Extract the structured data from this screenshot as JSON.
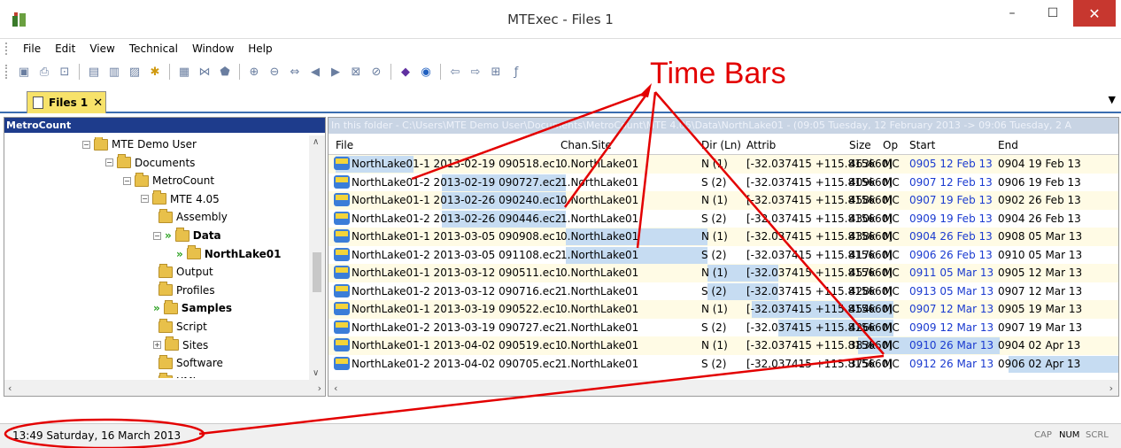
{
  "window": {
    "title": "MTExec - Files 1",
    "minimize": "–",
    "maximize": "☐",
    "close": "✕"
  },
  "menu": {
    "items": [
      "File",
      "Edit",
      "View",
      "Technical",
      "Window",
      "Help"
    ]
  },
  "tab": {
    "label": "Files 1",
    "close": "✕"
  },
  "left_pane": {
    "header": "MetroCount",
    "tree": [
      {
        "label": "MTE Demo User",
        "expander": "-",
        "bold": false,
        "arrows": false
      },
      {
        "label": "Documents",
        "expander": "-",
        "bold": false,
        "arrows": false
      },
      {
        "label": "MetroCount",
        "expander": "-",
        "bold": false,
        "arrows": false
      },
      {
        "label": "MTE 4.05",
        "expander": "-",
        "bold": false,
        "arrows": false
      },
      {
        "label": "Assembly",
        "expander": "",
        "bold": false,
        "arrows": false
      },
      {
        "label": "Data",
        "expander": "-",
        "bold": true,
        "arrows": true
      },
      {
        "label": "NorthLake01",
        "expander": "",
        "bold": true,
        "arrows": true
      },
      {
        "label": "Output",
        "expander": "",
        "bold": false,
        "arrows": false
      },
      {
        "label": "Profiles",
        "expander": "",
        "bold": false,
        "arrows": false
      },
      {
        "label": "Samples",
        "expander": "",
        "bold": true,
        "arrows": true
      },
      {
        "label": "Script",
        "expander": "",
        "bold": false,
        "arrows": false
      },
      {
        "label": "Sites",
        "expander": "+",
        "bold": false,
        "arrows": false
      },
      {
        "label": "Software",
        "expander": "",
        "bold": false,
        "arrows": false
      },
      {
        "label": "XML",
        "expander": "",
        "bold": false,
        "arrows": false
      }
    ]
  },
  "right_pane": {
    "path": "In this folder - C:\\Users\\MTE Demo User\\Documents\\MetroCount\\MTE 4.05\\Data\\NorthLake01 - (09:05 Tuesday, 12 February 2013 -> 09:06 Tuesday, 2 A",
    "columns": [
      "File",
      "Chan.Site",
      "Dir (Ln)",
      "Attrib",
      "Size",
      "Op",
      "Start",
      "End"
    ],
    "rows": [
      {
        "file": "NorthLake01-1 2013-02-19 090518.ec1",
        "chan": "0.NorthLake01",
        "dir": "N (1)",
        "attrib": "[-32.037415 +115.815660]",
        "size": "463k",
        "op": "MC",
        "start": "0905 12 Feb 13",
        "end": "0904 19 Feb 13"
      },
      {
        "file": "NorthLake01-2 2013-02-19 090727.ec2",
        "chan": "1.NorthLake01",
        "dir": "S (2)",
        "attrib": "[-32.037415 +115.815660]",
        "size": "409k",
        "op": "MC",
        "start": "0907 12 Feb 13",
        "end": "0906 19 Feb 13"
      },
      {
        "file": "NorthLake01-1 2013-02-26 090240.ec1",
        "chan": "0.NorthLake01",
        "dir": "N (1)",
        "attrib": "[-32.037415 +115.815660]",
        "size": "458k",
        "op": "MC",
        "start": "0907 19 Feb 13",
        "end": "0902 26 Feb 13"
      },
      {
        "file": "NorthLake01-2 2013-02-26 090446.ec2",
        "chan": "1.NorthLake01",
        "dir": "S (2)",
        "attrib": "[-32.037415 +115.815660]",
        "size": "430k",
        "op": "MC",
        "start": "0909 19 Feb 13",
        "end": "0904 26 Feb 13"
      },
      {
        "file": "NorthLake01-1 2013-03-05 090908.ec1",
        "chan": "0.NorthLake01",
        "dir": "N (1)",
        "attrib": "[-32.037415 +115.815660]",
        "size": "438k",
        "op": "MC",
        "start": "0904 26 Feb 13",
        "end": "0908 05 Mar 13"
      },
      {
        "file": "NorthLake01-2 2013-03-05 091108.ec2",
        "chan": "1.NorthLake01",
        "dir": "S (2)",
        "attrib": "[-32.037415 +115.815660]",
        "size": "417k",
        "op": "MC",
        "start": "0906 26 Feb 13",
        "end": "0910 05 Mar 13"
      },
      {
        "file": "NorthLake01-1 2013-03-12 090511.ec1",
        "chan": "0.NorthLake01",
        "dir": "N (1)",
        "attrib": "[-32.037415 +115.815660]",
        "size": "457k",
        "op": "MC",
        "start": "0911 05 Mar 13",
        "end": "0905 12 Mar 13"
      },
      {
        "file": "NorthLake01-2 2013-03-12 090716.ec2",
        "chan": "1.NorthLake01",
        "dir": "S (2)",
        "attrib": "[-32.037415 +115.815660]",
        "size": "428k",
        "op": "MC",
        "start": "0913 05 Mar 13",
        "end": "0907 12 Mar 13"
      },
      {
        "file": "NorthLake01-1 2013-03-19 090522.ec1",
        "chan": "0.NorthLake01",
        "dir": "N (1)",
        "attrib": "[-32.037415 +115.815660]",
        "size": "454k",
        "op": "MC",
        "start": "0907 12 Mar 13",
        "end": "0905 19 Mar 13"
      },
      {
        "file": "NorthLake01-2 2013-03-19 090727.ec2",
        "chan": "1.NorthLake01",
        "dir": "S (2)",
        "attrib": "[-32.037415 +115.815660]",
        "size": "426k",
        "op": "MC",
        "start": "0909 12 Mar 13",
        "end": "0907 19 Mar 13"
      },
      {
        "file": "NorthLake01-1 2013-04-02 090519.ec1",
        "chan": "0.NorthLake01",
        "dir": "N (1)",
        "attrib": "[-32.037415 +115.815660]",
        "size": "383k",
        "op": "MC",
        "start": "0910 26 Mar 13",
        "end": "0904 02 Apr 13"
      },
      {
        "file": "NorthLake01-2 2013-04-02 090705.ec2",
        "chan": "1.NorthLake01",
        "dir": "S (2)",
        "attrib": "[-32.037415 +115.815660]",
        "size": "375k",
        "op": "MC",
        "start": "0912 26 Mar 13",
        "end": "0906 02 Apr 13"
      }
    ]
  },
  "status": {
    "text": "13:49 Saturday, 16 March 2013",
    "cap": "CAP",
    "num": "NUM",
    "scrl": "SCRL"
  },
  "annotation": {
    "text": "Time Bars",
    "color": "#e30000"
  },
  "colors": {
    "accent": "#1e3c8c",
    "tab": "#f7e26a",
    "highlight": "#c6dcf2",
    "start_text": "#1a3ad0"
  }
}
